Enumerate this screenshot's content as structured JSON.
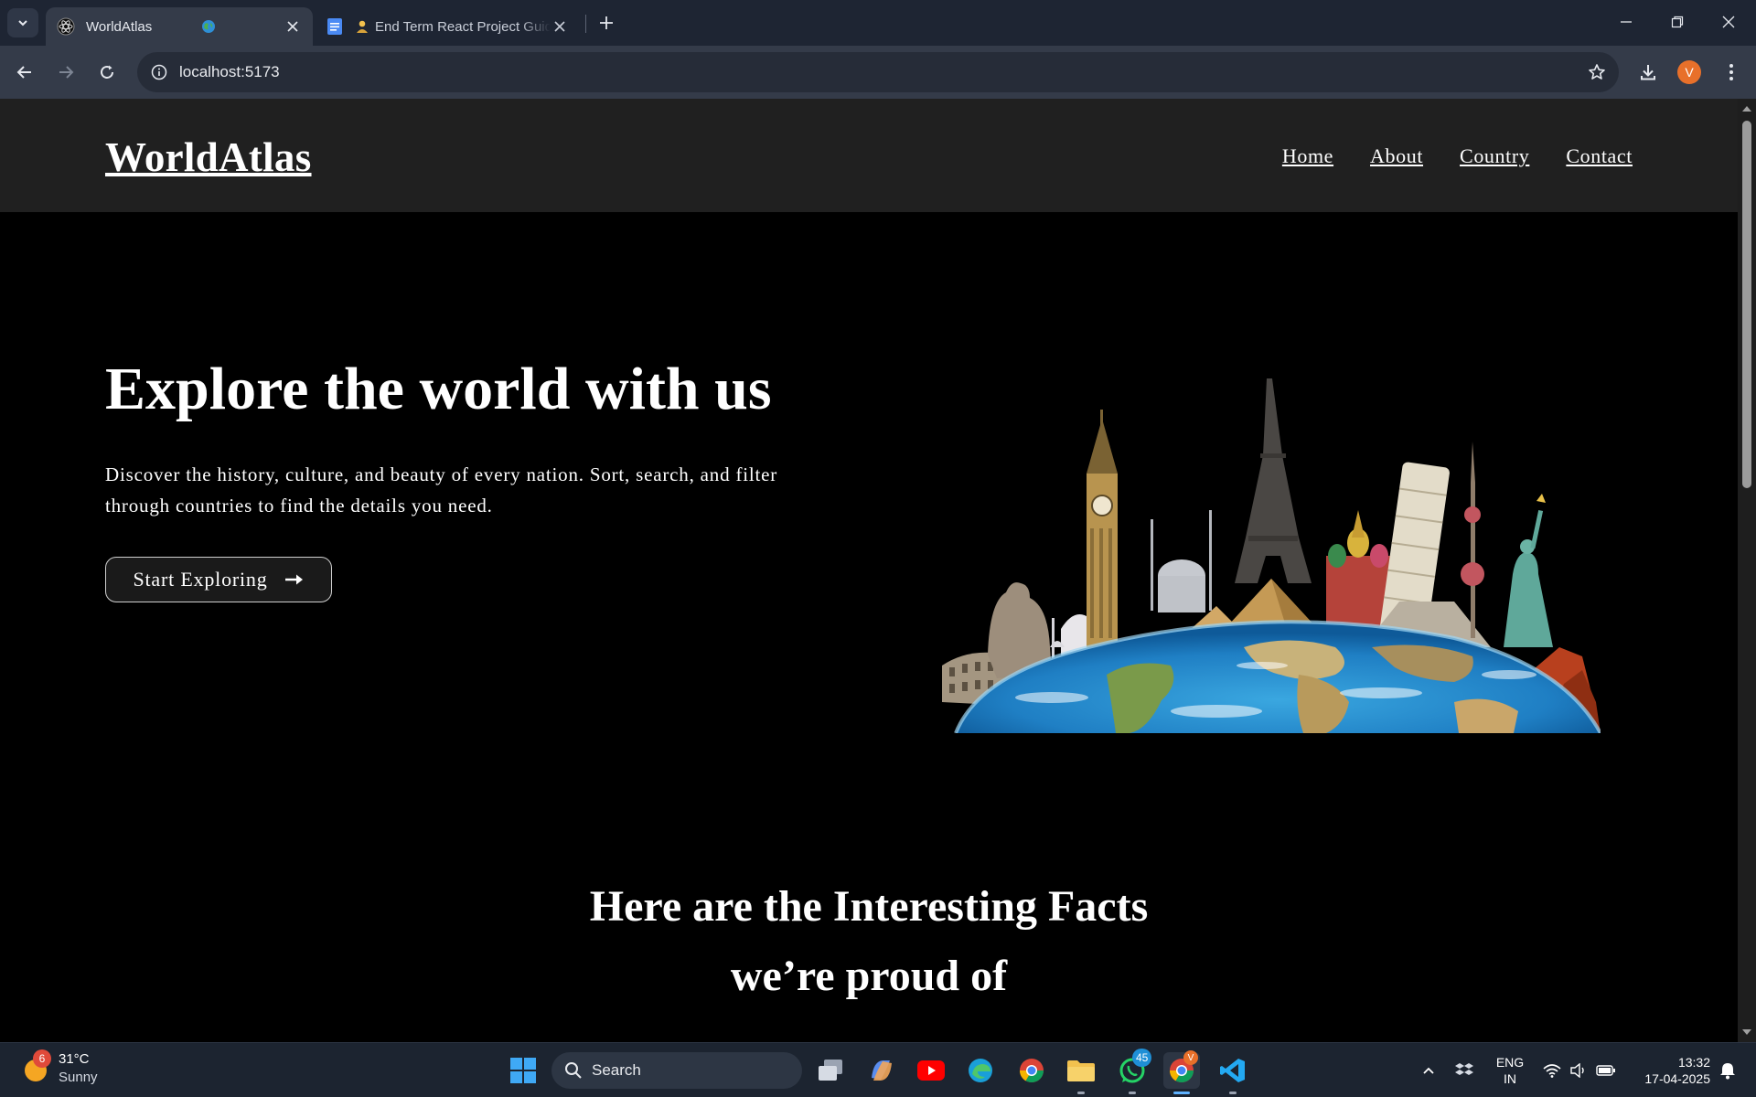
{
  "browser": {
    "tabs": [
      {
        "title": "WorldAtlas",
        "active": true
      },
      {
        "title": "End Term React Project Guide",
        "active": false
      }
    ],
    "url": "localhost:5173",
    "profile_initial": "V"
  },
  "site": {
    "logo": "WorldAtlas",
    "nav": [
      "Home",
      "About",
      "Country",
      "Contact"
    ],
    "hero": {
      "title": "Explore the world with us",
      "description": "Discover the history, culture, and beauty of every nation. Sort, search, and filter through countries to find the details you need.",
      "cta_label": "Start Exploring"
    },
    "facts_heading_line1": "Here are the Interesting Facts",
    "facts_heading_line2": "we’re proud of"
  },
  "taskbar": {
    "weather_temp": "31°C",
    "weather_condition": "Sunny",
    "weather_badge": "6",
    "search_label": "Search",
    "whatsapp_badge": "45",
    "chrome_badge": "V",
    "lang_line1": "ENG",
    "lang_line2": "IN",
    "time": "13:32",
    "date": "17-04-2025"
  },
  "colors": {
    "page_bg": "#000000",
    "header_bg": "#202020",
    "chrome_dark": "#1e2533",
    "chrome_toolbar": "#343b49",
    "accent_avatar": "#e8702a"
  }
}
